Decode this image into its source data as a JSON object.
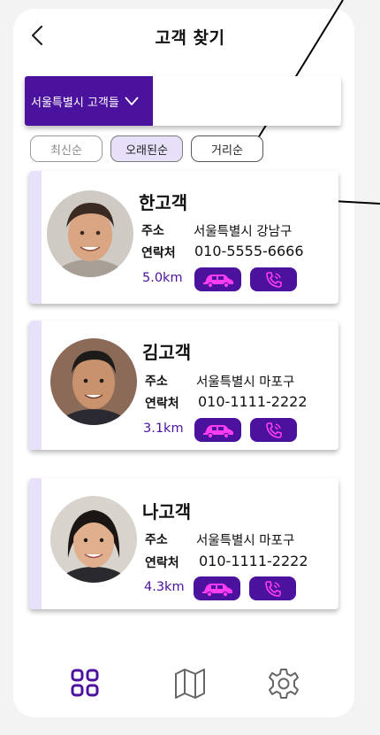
{
  "header": {
    "title": "고객 찾기"
  },
  "region": {
    "selected": "서울특별시 고객들"
  },
  "sort": {
    "latest": "최신순",
    "oldest": "오래된순",
    "distance": "거리순"
  },
  "labels": {
    "address": "주소",
    "contact": "연락처"
  },
  "customers": [
    {
      "name": "한고객",
      "address": "서울특별시 강남구",
      "phone": "010-5555-6666",
      "distance": "5.0km"
    },
    {
      "name": "김고객",
      "address": "서울특별시 마포구",
      "phone": "010-1111-2222",
      "distance": "3.1km"
    },
    {
      "name": "나고객",
      "address": "서울특별시 마포구",
      "phone": "010-1111-2222",
      "distance": "4.3km"
    }
  ],
  "colors": {
    "accent": "#4b129e",
    "card_stripe": "#e9e1fb",
    "sort_active": "#e8e0f9"
  },
  "icons": {
    "car": "car-icon",
    "phone": "phone-icon",
    "grid": "grid-icon",
    "map": "map-icon",
    "settings": "gear-icon"
  }
}
